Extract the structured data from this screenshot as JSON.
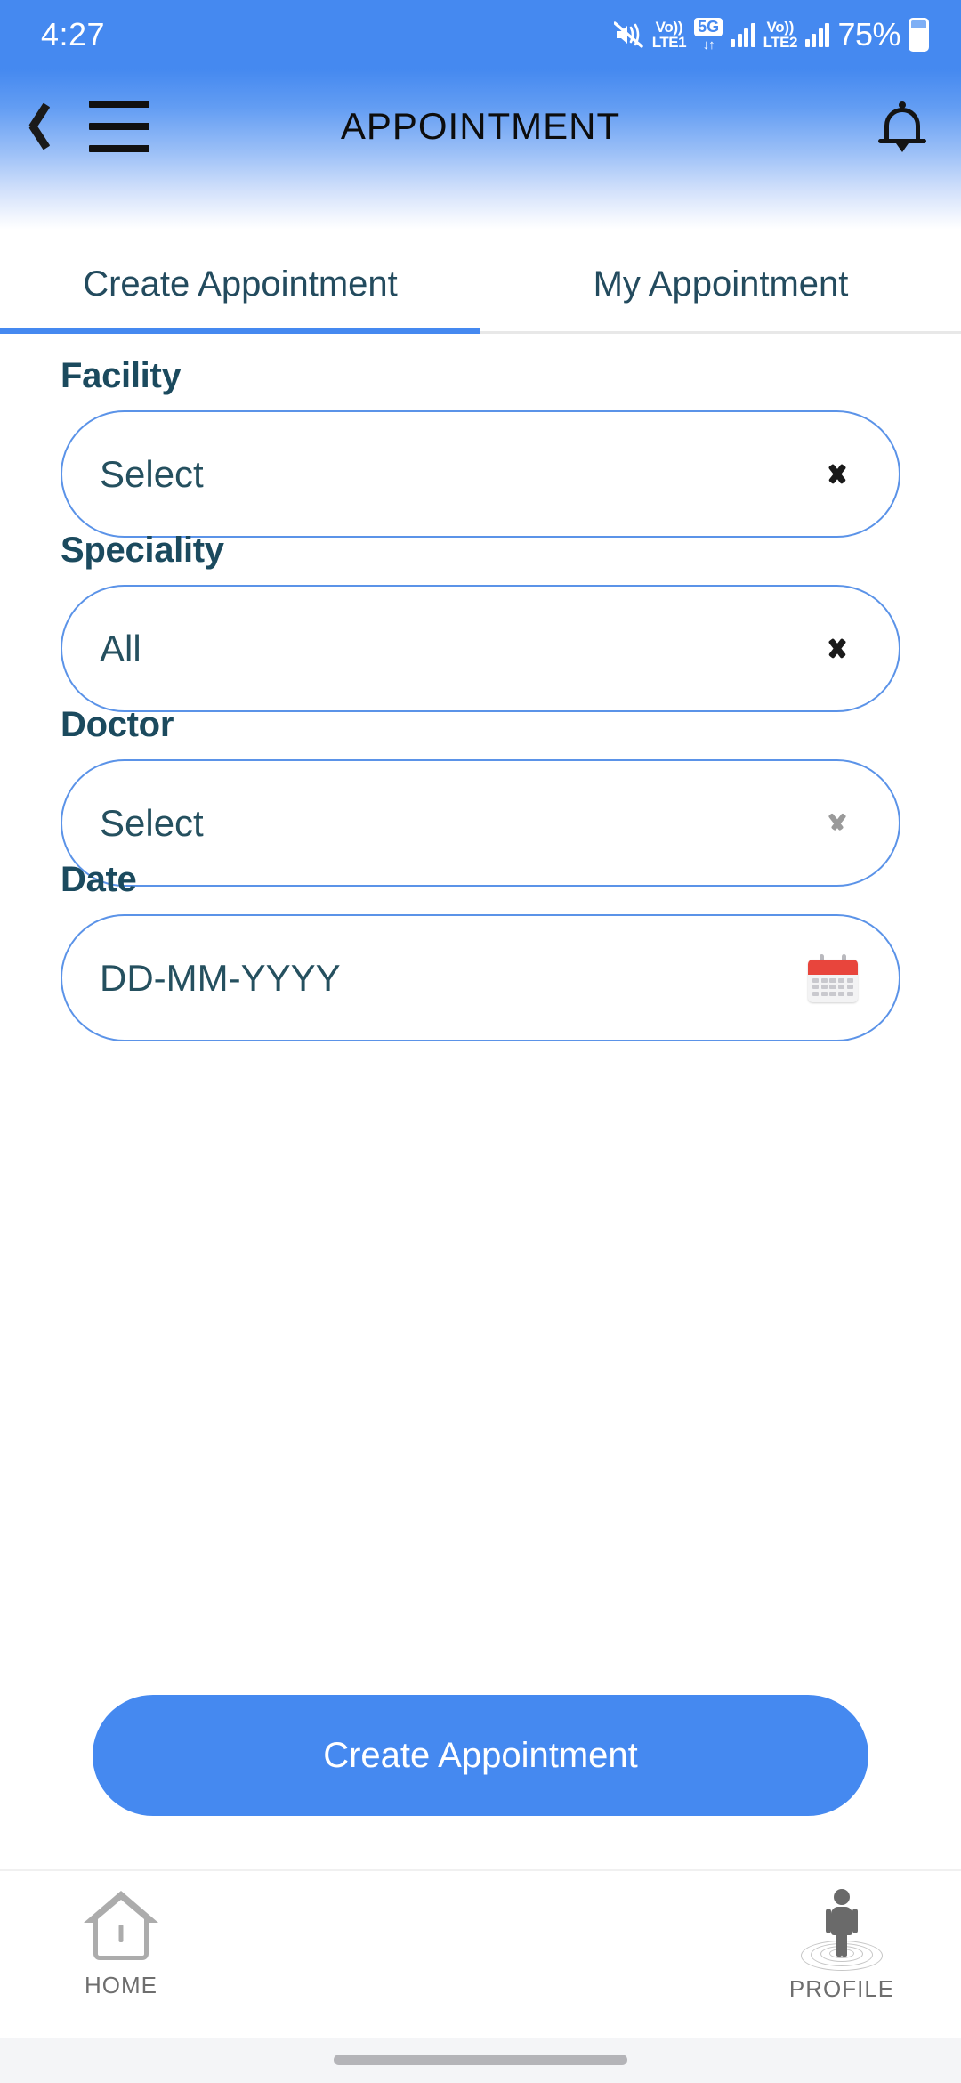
{
  "status_bar": {
    "time": "4:27",
    "mute_icon": "mute-icon",
    "volte1_top": "Vo))",
    "volte1_bottom": "LTE1",
    "network_badge": "5G",
    "data_arrows": "↓↑",
    "volte2_top": "Vo))",
    "volte2_bottom": "LTE2",
    "battery_percent": "75%",
    "signal_icon": "signal-bars-icon",
    "battery_icon": "battery-icon"
  },
  "header": {
    "title": "APPOINTMENT",
    "back_icon": "back-chevron-icon",
    "menu_icon": "hamburger-menu-icon",
    "notification_icon": "bell-icon",
    "gradient_from": "#4589F0",
    "gradient_to": "#FFFFFF"
  },
  "tabs": {
    "active_index": 0,
    "indicator_color": "#4589F0",
    "items": [
      {
        "label": "Create Appointment"
      },
      {
        "label": "My Appointment"
      }
    ]
  },
  "form": {
    "fields": [
      {
        "label": "Facility",
        "value": "Select",
        "control": "dropdown",
        "icon": "chevron-down-icon",
        "enabled": true
      },
      {
        "label": "Speciality",
        "value": "All",
        "control": "dropdown",
        "icon": "chevron-down-icon",
        "enabled": true
      },
      {
        "label": "Doctor",
        "value": "Select",
        "control": "dropdown",
        "icon": "chevron-down-icon",
        "enabled": false
      },
      {
        "label": "Date",
        "value": "DD-MM-YYYY",
        "control": "date",
        "icon": "calendar-icon",
        "enabled": true
      }
    ],
    "border_color": "#5B93E8",
    "label_color": "#1B4A5E"
  },
  "primary_action": {
    "label": "Create Appointment",
    "color": "#4589F0"
  },
  "bottom_nav": {
    "items": [
      {
        "label": "HOME",
        "icon": "home-icon"
      },
      {
        "label": "PROFILE",
        "icon": "profile-person-icon"
      }
    ]
  }
}
